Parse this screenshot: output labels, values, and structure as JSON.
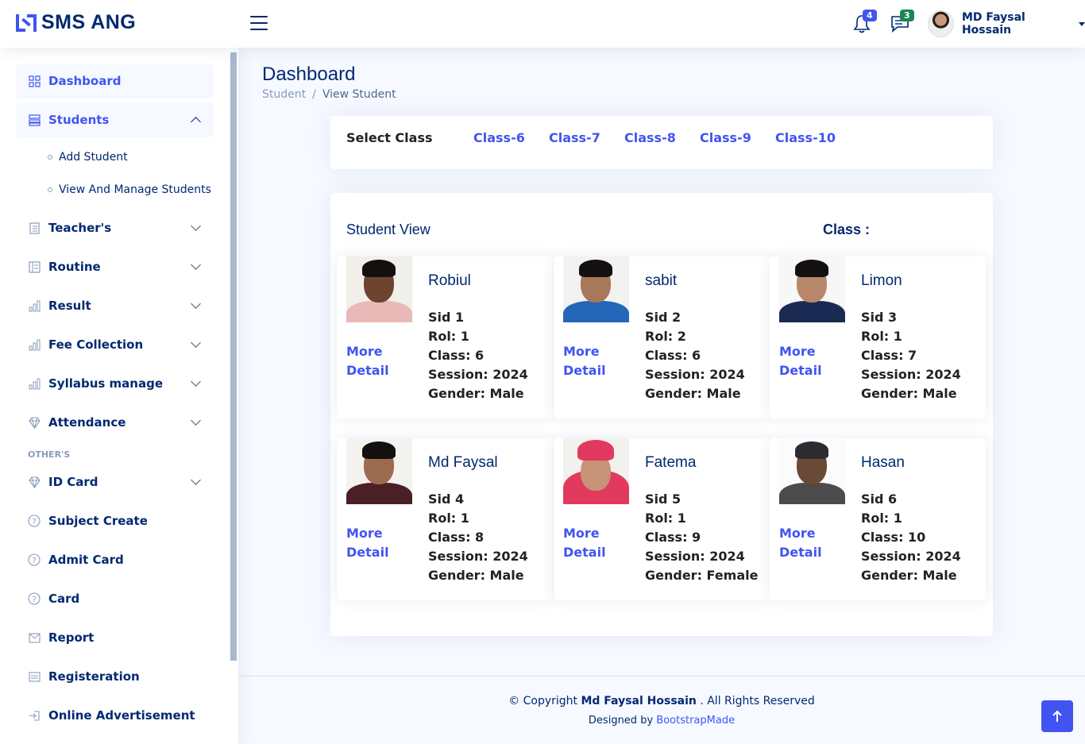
{
  "header": {
    "logo_text": "SMS ANG",
    "notifications_count": "4",
    "messages_count": "3",
    "user_name": "MD Faysal Hossain"
  },
  "sidebar": {
    "dashboard": "Dashboard",
    "students": "Students",
    "add_student": "Add Student",
    "manage_students": "View And Manage Students",
    "teachers": "Teacher's",
    "routine": "Routine",
    "result": "Result",
    "fee": "Fee Collection",
    "syllabus": "Syllabus manage",
    "attendance": "Attendance",
    "others_heading": "OTHER'S",
    "id_card": "ID Card",
    "subject_create": "Subject Create",
    "admit_card": "Admit Card",
    "card": "Card",
    "report": "Report",
    "registration": "Registeration",
    "online_ad": "Online Advertisement"
  },
  "main": {
    "page_title": "Dashboard",
    "breadcrumb": [
      "Student",
      "View Student"
    ],
    "select_class_label": "Select Class",
    "classes": [
      "Class-6",
      "Class-7",
      "Class-8",
      "Class-9",
      "Class-10"
    ],
    "view_title": "Student View",
    "class_heading": "Class :",
    "more_detail": "More Detail",
    "students": [
      {
        "name": "Robiul",
        "sid": "Sid 1",
        "roll": "Rol: 1",
        "class": "Class: 6",
        "session": "Session: 2024",
        "gender": "Gender: Male"
      },
      {
        "name": "sabit",
        "sid": "Sid 2",
        "roll": "Rol: 2",
        "class": "Class: 6",
        "session": "Session: 2024",
        "gender": "Gender: Male"
      },
      {
        "name": "Limon",
        "sid": "Sid 3",
        "roll": "Rol: 1",
        "class": "Class: 7",
        "session": "Session: 2024",
        "gender": "Gender: Male"
      },
      {
        "name": "Md Faysal",
        "sid": "Sid 4",
        "roll": "Rol: 1",
        "class": "Class: 8",
        "session": "Session: 2024",
        "gender": "Gender: Male"
      },
      {
        "name": "Fatema",
        "sid": "Sid 5",
        "roll": "Rol: 1",
        "class": "Class: 9",
        "session": "Session: 2024",
        "gender": "Gender: Female"
      },
      {
        "name": "Hasan",
        "sid": "Sid 6",
        "roll": "Rol: 1",
        "class": "Class: 10",
        "session": "Session: 2024",
        "gender": "Gender: Male"
      }
    ]
  },
  "footer": {
    "copyright_prefix": "© Copyright",
    "copyright_name": "Md Faysal Hossain",
    "copyright_suffix": ". All Rights Reserved",
    "designed_prefix": "Designed by",
    "designed_link": "BootstrapMade"
  },
  "colors": {
    "accent": "#4154f1",
    "navy": "#012970",
    "background": "#f6f9ff"
  }
}
